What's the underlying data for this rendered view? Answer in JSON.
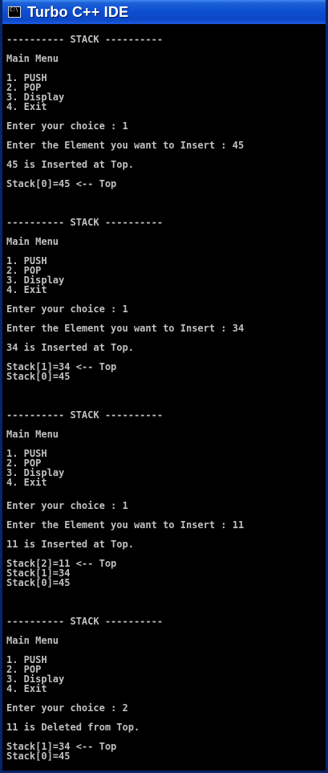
{
  "window": {
    "title": "Turbo C++ IDE",
    "icon_text": "C:\\"
  },
  "console": {
    "lines": [
      "---------- STACK ----------",
      "Main Menu",
      "1. PUSH",
      "2. POP",
      "3. Display",
      "4. Exit",
      "Enter your choice : 1",
      "Enter the Element you want to Insert : 45",
      "45 is Inserted at Top.",
      "Stack[0]=45 <-- Top",
      "---------- STACK ----------",
      "Main Menu",
      "1. PUSH",
      "2. POP",
      "3. Display",
      "4. Exit",
      "Enter your choice : 1",
      "Enter the Element you want to Insert : 34",
      "34 is Inserted at Top.",
      "Stack[1]=34 <-- Top",
      "Stack[0]=45",
      "---------- STACK ----------",
      "Main Menu",
      "1. PUSH",
      "2. POP",
      "3. Display",
      "4. Exit",
      "Enter your choice : 1",
      "Enter the Element you want to Insert : 11",
      "11 is Inserted at Top.",
      "Stack[2]=11 <-- Top",
      "Stack[1]=34",
      "Stack[0]=45",
      "---------- STACK ----------",
      "Main Menu",
      "1. PUSH",
      "2. POP",
      "3. Display",
      "4. Exit",
      "Enter your choice : 2",
      "11 is Deleted from Top.",
      "Stack[1]=34 <-- Top",
      "Stack[0]=45"
    ]
  }
}
